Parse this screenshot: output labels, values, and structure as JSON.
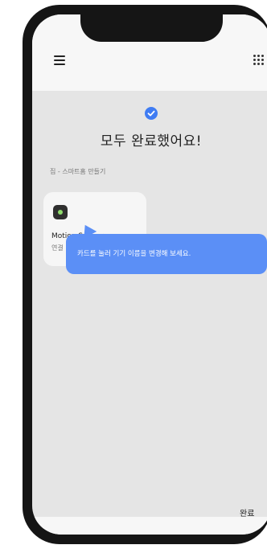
{
  "header": {
    "menu_icon": "hamburger-menu-icon",
    "apps_icon": "grid-dots-icon"
  },
  "main": {
    "status_icon": "check-circle-icon",
    "accent_color": "#3f7cf3",
    "title": "모두 완료했어요!",
    "breadcrumb": "집 - 스마트홈 만들기",
    "device_card": {
      "icon": "motion-sensor-icon",
      "name": "Motion Sensor",
      "status": "연결"
    },
    "tooltip": {
      "text": "카드를 눌러 기기 이름을 변경해 보세요.",
      "color": "#5b8ff6"
    },
    "done_label": "완료"
  }
}
